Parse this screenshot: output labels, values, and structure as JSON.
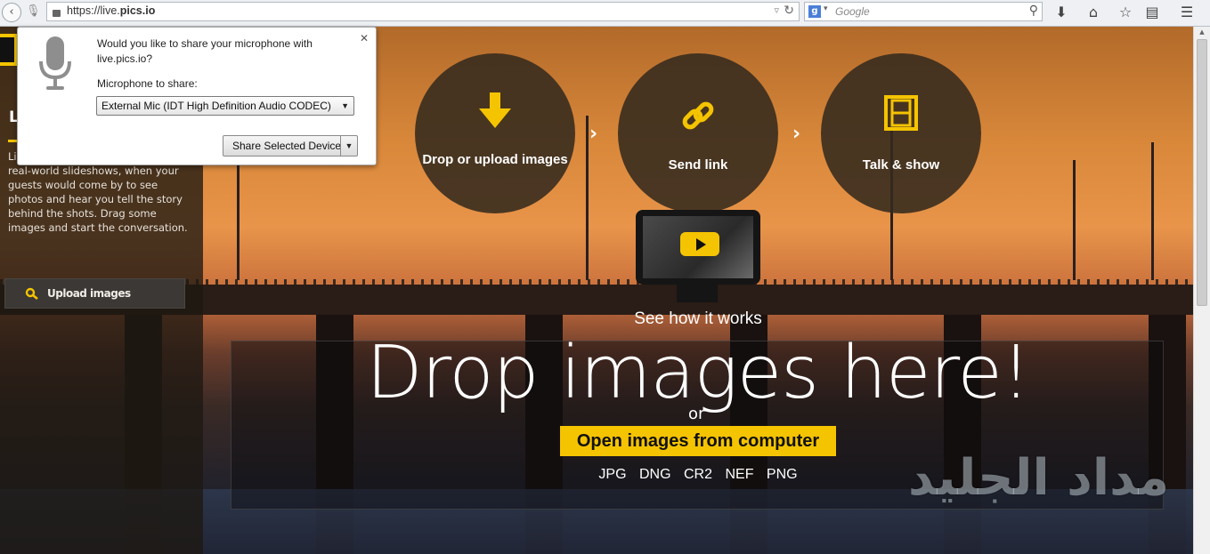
{
  "browser": {
    "url_prefix": "https://live.",
    "url_domain": "pics.io",
    "search_placeholder": "Google"
  },
  "left_panel": {
    "title": "Li",
    "description": "Li                         experience of real-world slideshows, when your guests would come by to see photos and hear you tell the story behind the shots. Drag some images and start the conversation.",
    "upload_label": "Upload images"
  },
  "mic_popup": {
    "question": "Would you like to share your microphone with live.pics.io?",
    "select_label": "Microphone to share:",
    "selected_device": "External Mic (IDT High Definition Audio CODEC)",
    "share_button": "Share Selected Device"
  },
  "steps": [
    {
      "label": "Drop or upload images",
      "icon": "arrow-down-icon"
    },
    {
      "label": "Send link",
      "icon": "link-icon"
    },
    {
      "label": "Talk & show",
      "icon": "film-icon"
    }
  ],
  "video": {
    "caption": "See how it works"
  },
  "dropzone": {
    "title": "Drop images here!",
    "or": "or",
    "open_button": "Open images from computer",
    "formats": [
      "JPG",
      "DNG",
      "CR2",
      "NEF",
      "PNG"
    ]
  },
  "watermark": "مداد الجليد",
  "colors": {
    "accent": "#f5c400"
  }
}
